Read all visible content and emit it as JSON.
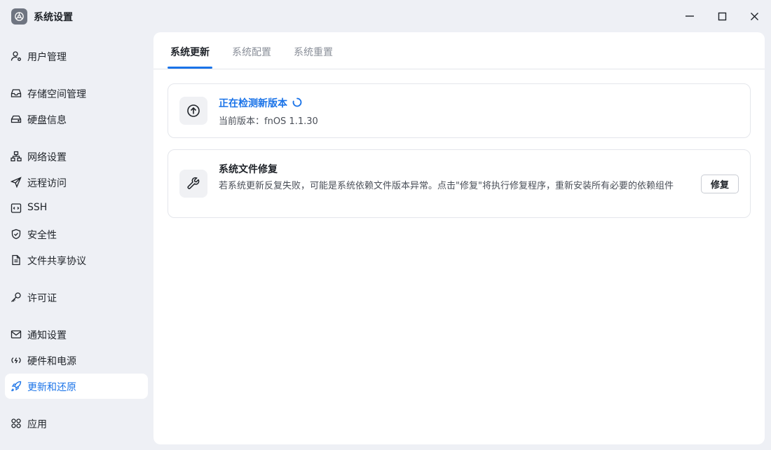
{
  "window": {
    "title": "系统设置",
    "app_icon": "settings-app-icon",
    "controls": [
      "minimize-icon",
      "maximize-icon",
      "close-icon"
    ]
  },
  "sidebar": {
    "items": [
      {
        "label": "用户管理",
        "icon": "user-icon"
      },
      {
        "label": "存储空间管理",
        "icon": "storage-icon"
      },
      {
        "label": "硬盘信息",
        "icon": "disk-icon"
      },
      {
        "label": "网络设置",
        "icon": "network-icon"
      },
      {
        "label": "远程访问",
        "icon": "send-icon"
      },
      {
        "label": "SSH",
        "icon": "ssh-icon"
      },
      {
        "label": "安全性",
        "icon": "shield-icon"
      },
      {
        "label": "文件共享协议",
        "icon": "document-icon"
      },
      {
        "label": "许可证",
        "icon": "key-icon"
      },
      {
        "label": "通知设置",
        "icon": "mail-icon"
      },
      {
        "label": "硬件和电源",
        "icon": "power-icon"
      },
      {
        "label": "更新和还原",
        "icon": "rocket-icon",
        "active": true
      },
      {
        "label": "应用",
        "icon": "apps-icon"
      }
    ]
  },
  "tabs": [
    {
      "label": "系统更新",
      "active": true
    },
    {
      "label": "系统配置"
    },
    {
      "label": "系统重置"
    }
  ],
  "update_card": {
    "title": "正在检测新版本",
    "subtitle": "当前版本：fnOS 1.1.30",
    "icon": "arrow-up-circle-icon",
    "status_icon": "loading-spinner-icon"
  },
  "repair_card": {
    "title": "系统文件修复",
    "description": "若系统更新反复失败，可能是系统依赖文件版本异常。点击\"修复\"将执行修复程序，重新安装所有必要的依赖组件",
    "icon": "wrench-icon",
    "button_label": "修复"
  },
  "colors": {
    "accent": "#1a73e8",
    "background": "#eef0f5",
    "panel": "#ffffff",
    "text": "#1f2329",
    "muted": "#8a8f99"
  }
}
